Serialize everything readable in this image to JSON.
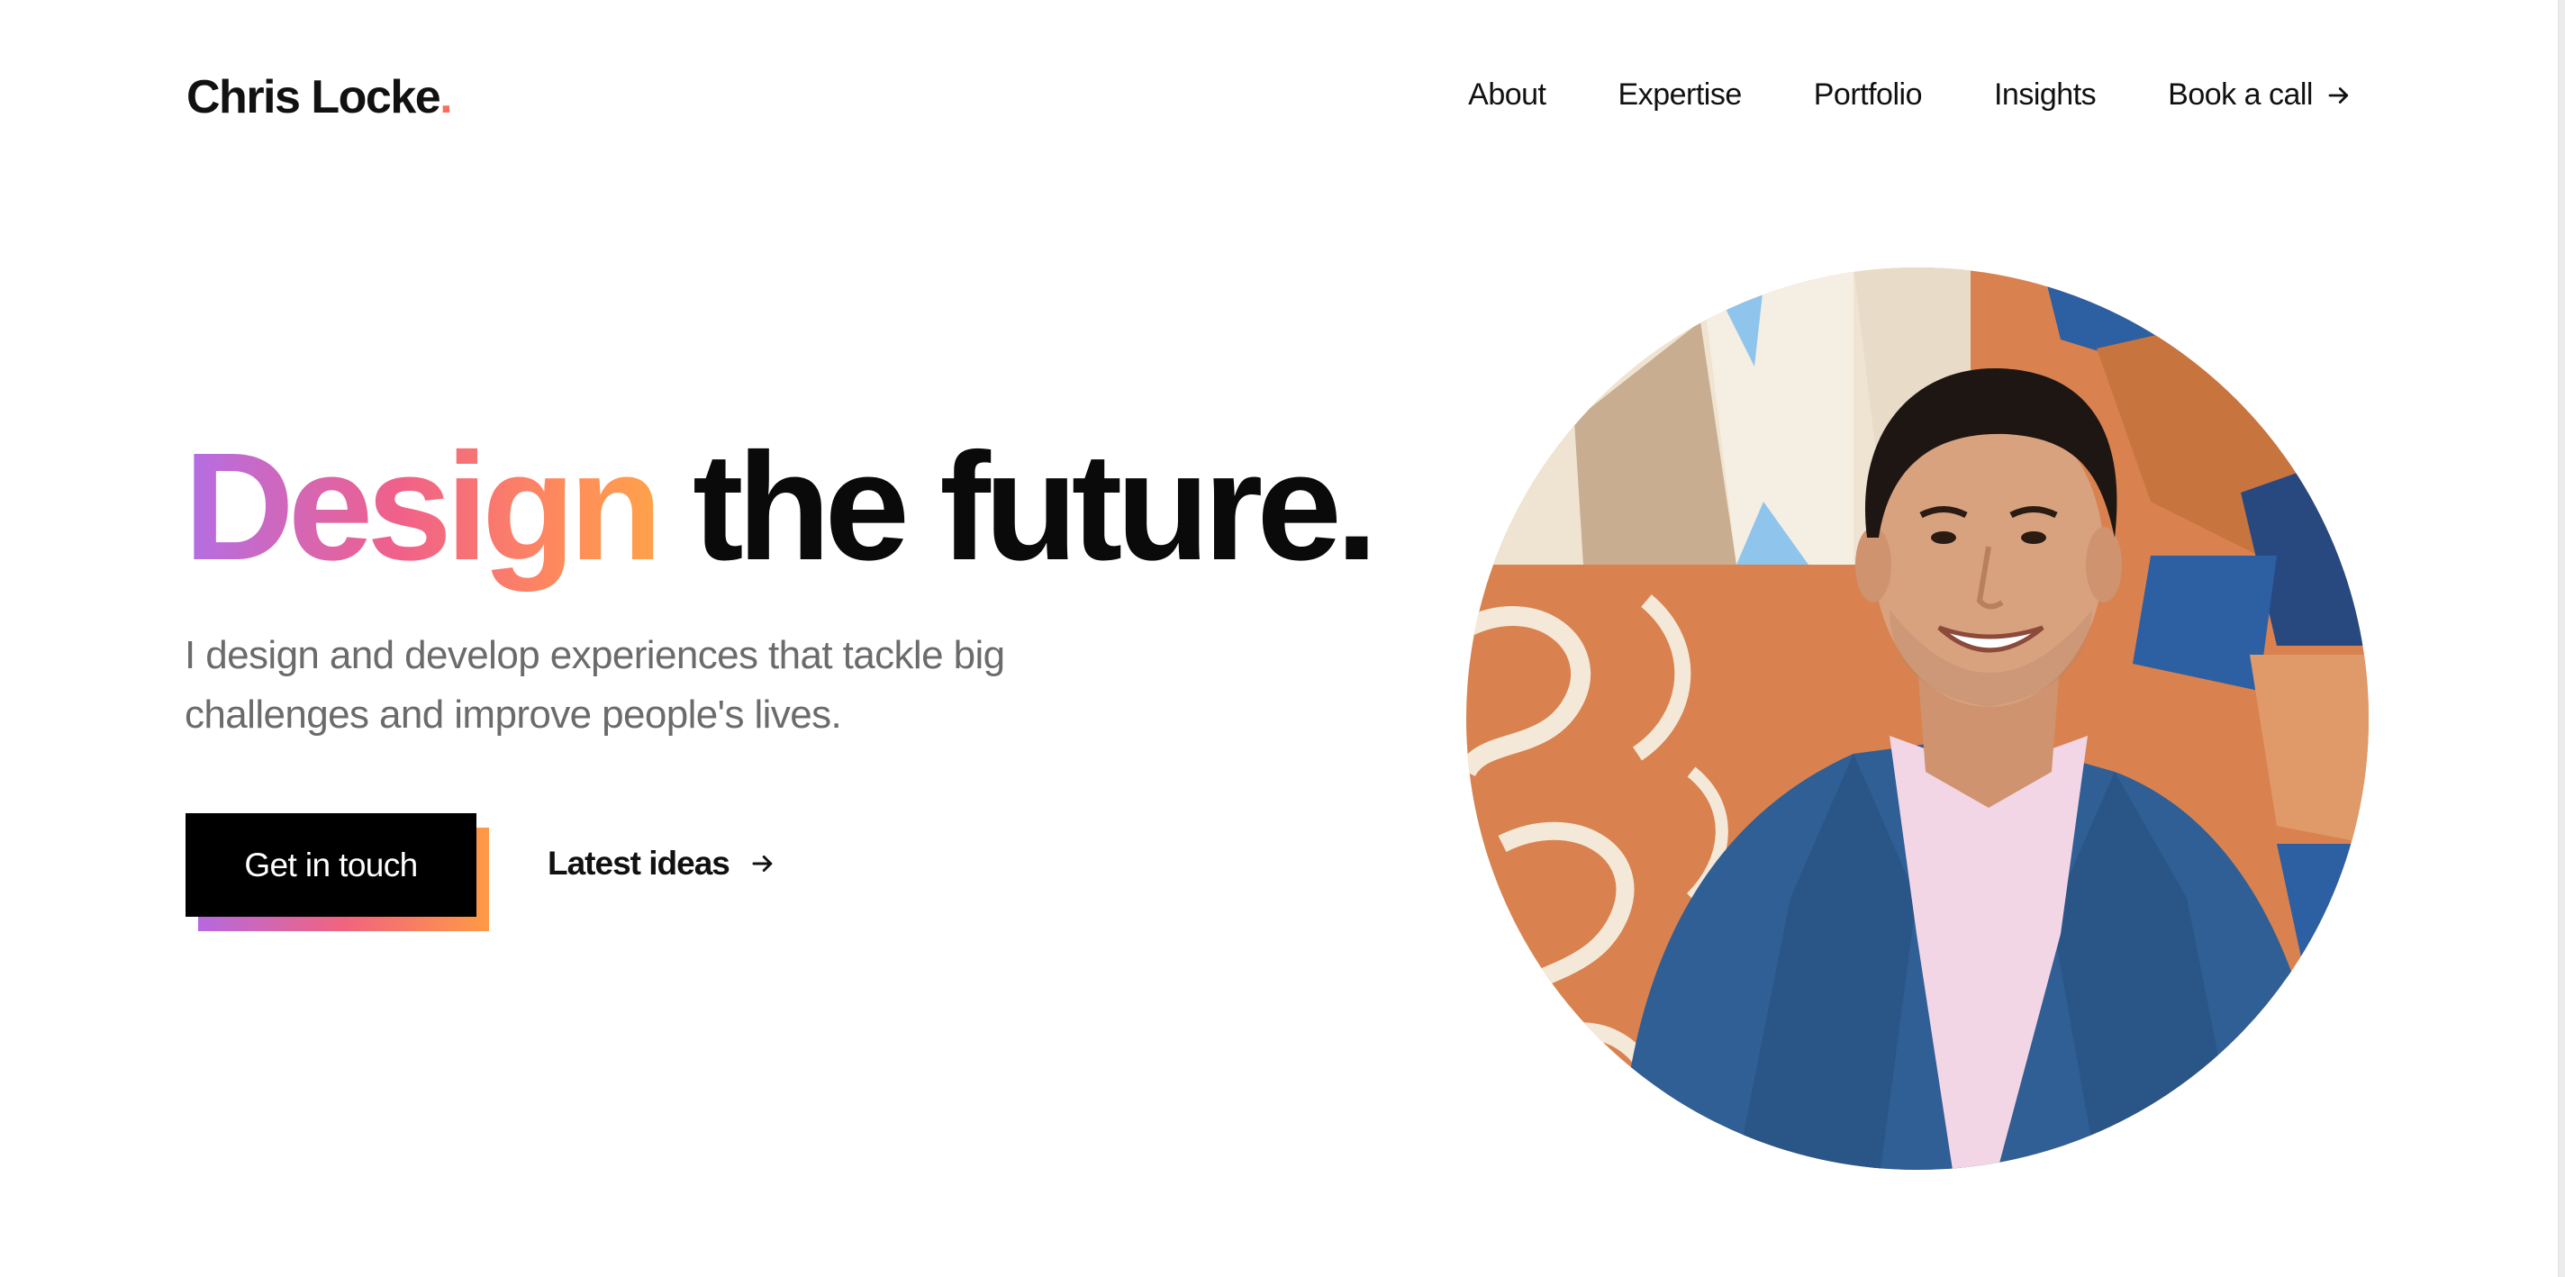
{
  "brand": {
    "name": "Chris Locke",
    "dot": ".",
    "dot_color": "#ff6e5a"
  },
  "nav": {
    "items": [
      "About",
      "Expertise",
      "Portfolio",
      "Insights"
    ],
    "cta_label": "Book a call",
    "cta_icon": "arrow-right-icon"
  },
  "hero": {
    "headline_accent": "Design",
    "headline_rest": "the future.",
    "subhead_line1": "I design and develop experiences that tackle big",
    "subhead_line2": "challenges and improve people's lives.",
    "primary_cta": "Get in touch",
    "secondary_cta": "Latest ideas",
    "secondary_icon": "arrow-right-icon",
    "gradient_colors": [
      "#b36ee6",
      "#f0608a",
      "#ff8a5c",
      "#ffa24a"
    ]
  },
  "portrait": {
    "icon": "profile-photo",
    "colors": {
      "jacket": "#2f5f94",
      "shirt": "#f3d6e6",
      "skin": "#d9a27f",
      "hair": "#1e1612",
      "tile_orange": "#d9824f",
      "tile_blue": "#2d5fa3",
      "tile_cream": "#efe4d2"
    }
  }
}
